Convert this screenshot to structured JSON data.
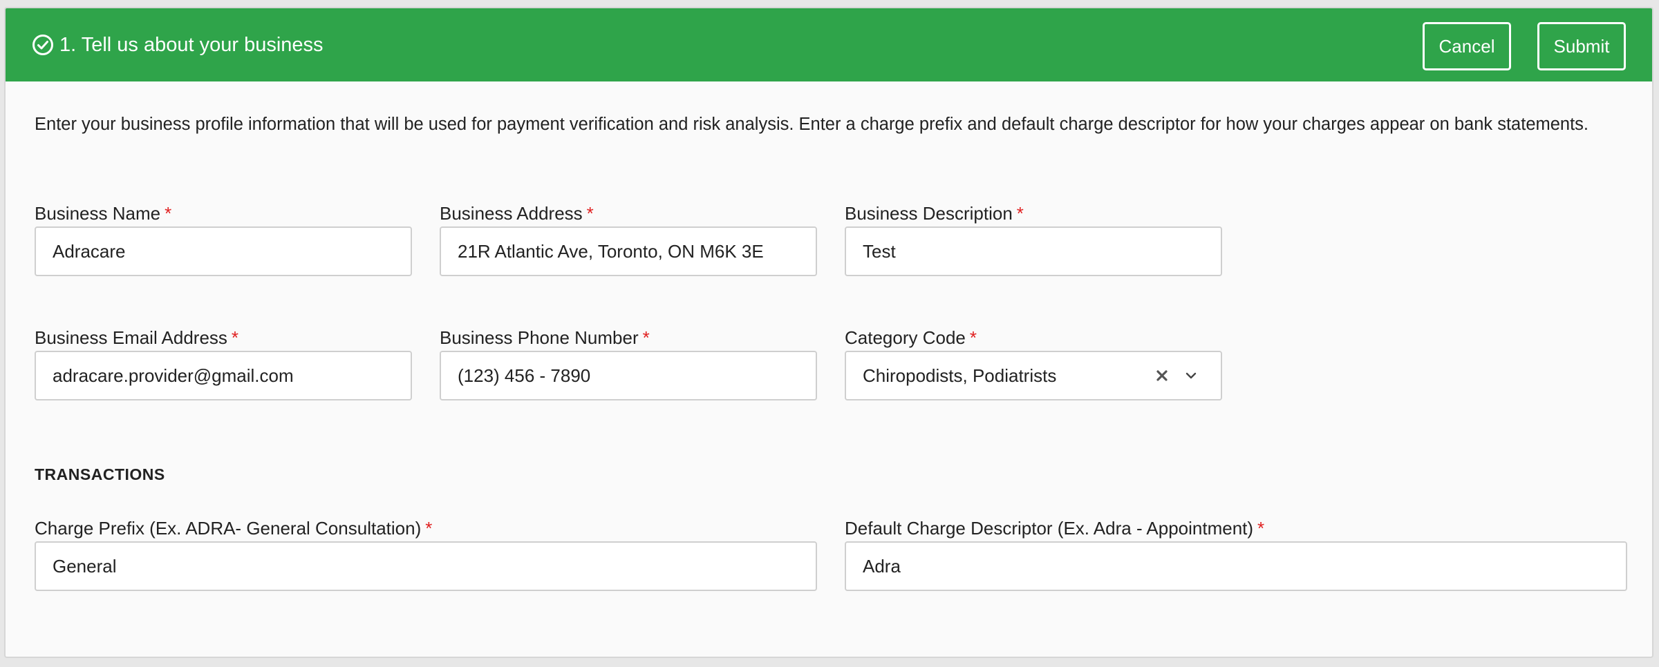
{
  "header": {
    "title": "1. Tell us about your business",
    "icon": "check-circle-icon",
    "cancel_label": "Cancel",
    "submit_label": "Submit"
  },
  "intro": "Enter your business profile information that will be used for payment verification and risk analysis. Enter a charge prefix and default charge descriptor for how your charges appear on bank statements.",
  "fields": {
    "business_name": {
      "label": "Business Name",
      "value": "Adracare"
    },
    "business_address": {
      "label": "Business Address",
      "value": "21R Atlantic Ave, Toronto, ON M6K 3E"
    },
    "business_description": {
      "label": "Business Description",
      "value": "Test"
    },
    "business_email": {
      "label": "Business Email Address",
      "value": "adracare.provider@gmail.com"
    },
    "business_phone": {
      "label": "Business Phone Number",
      "value": "(123) 456 - 7890"
    },
    "category_code": {
      "label": "Category Code",
      "value": "Chiropodists, Podiatrists"
    },
    "charge_prefix": {
      "label": "Charge Prefix (Ex. ADRA- General Consultation)",
      "value": "General"
    },
    "charge_descriptor": {
      "label": "Default Charge Descriptor (Ex. Adra - Appointment)",
      "value": "Adra"
    }
  },
  "required_marker": "*",
  "transactions_title": "TRANSACTIONS",
  "colors": {
    "header_bg": "#2fa44a",
    "required": "#e02020"
  }
}
